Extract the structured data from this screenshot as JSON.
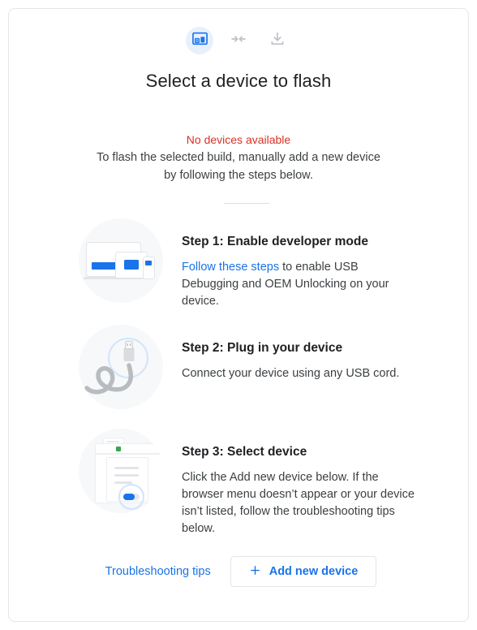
{
  "dialog": {
    "title": "Select a device to flash",
    "stepper": [
      {
        "icon": "device-icon",
        "state": "active",
        "color": "#1a73e8"
      },
      {
        "icon": "connect-arrows-icon",
        "state": "inactive",
        "color": "#bdc1c6"
      },
      {
        "icon": "download-icon",
        "state": "inactive",
        "color": "#bdc1c6"
      }
    ],
    "status": {
      "error": "No devices available",
      "error_color": "#d93025",
      "help": "To flash the selected build, manually add a new device by following the steps below."
    },
    "steps": [
      {
        "illustration": "devices-illustration",
        "heading": "Step 1: Enable developer mode",
        "link_text": "Follow these steps",
        "text_after_link": " to enable USB Debugging and OEM Unlocking on your device."
      },
      {
        "illustration": "usb-cable-illustration",
        "heading": "Step 2: Plug in your device",
        "text": "Connect your device using any USB cord."
      },
      {
        "illustration": "browser-window-illustration",
        "heading": "Step 3: Select device",
        "text": "Click the Add new device below. If the browser menu doesn’t appear or your device isn’t listed, follow the troubleshooting tips below."
      }
    ],
    "actions": {
      "troubleshooting_label": "Troubleshooting tips",
      "add_device_label": "Add new device",
      "add_device_icon": "plus-icon",
      "accent_color": "#1a73e8"
    }
  }
}
